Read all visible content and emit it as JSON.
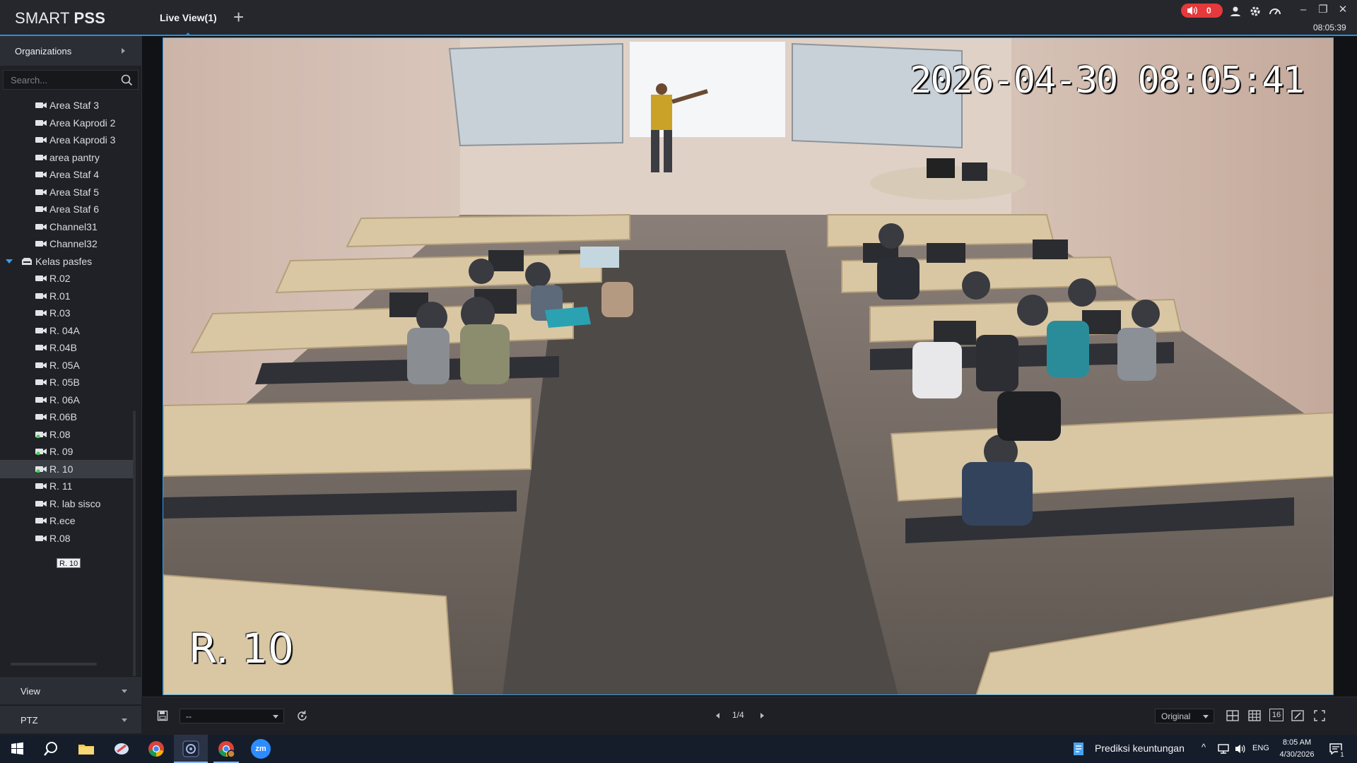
{
  "app": {
    "logo_light": "SMART ",
    "logo_bold": "PSS",
    "tab_label": "Live View(1)",
    "add_tab": "+",
    "alarm_count": "0",
    "clock": "08:05:39",
    "colors": {
      "accent": "#2b8fd6",
      "alarm": "#e5393b",
      "online_dot": "#3ecf4a"
    }
  },
  "sidebar": {
    "organizations_label": "Organizations",
    "search_placeholder": "Search...",
    "tree": [
      {
        "label": "Area Staf 3",
        "type": "camera",
        "online": false
      },
      {
        "label": "Area Kaprodi 2",
        "type": "camera",
        "online": false
      },
      {
        "label": "Area Kaprodi 3",
        "type": "camera",
        "online": false
      },
      {
        "label": "area pantry",
        "type": "camera",
        "online": false
      },
      {
        "label": "Area Staf 4",
        "type": "camera",
        "online": false
      },
      {
        "label": "Area Staf 5",
        "type": "camera",
        "online": false
      },
      {
        "label": "Area Staf 6",
        "type": "camera",
        "online": false
      },
      {
        "label": "Channel31",
        "type": "camera",
        "online": false
      },
      {
        "label": "Channel32",
        "type": "camera",
        "online": false
      },
      {
        "label": "Kelas pasfes",
        "type": "group",
        "online": false
      },
      {
        "label": "R.02",
        "type": "camera",
        "online": false
      },
      {
        "label": "R.01",
        "type": "camera",
        "online": false
      },
      {
        "label": "R.03",
        "type": "camera",
        "online": false
      },
      {
        "label": "R. 04A",
        "type": "camera",
        "online": false
      },
      {
        "label": "R.04B",
        "type": "camera",
        "online": false
      },
      {
        "label": "R. 05A",
        "type": "camera",
        "online": false
      },
      {
        "label": "R. 05B",
        "type": "camera",
        "online": false
      },
      {
        "label": "R. 06A",
        "type": "camera",
        "online": false
      },
      {
        "label": "R.06B",
        "type": "camera",
        "online": false
      },
      {
        "label": "R.08",
        "type": "camera",
        "online": true
      },
      {
        "label": "R. 09",
        "type": "camera",
        "online": true
      },
      {
        "label": "R. 10",
        "type": "camera",
        "online": true,
        "selected": true
      },
      {
        "label": "R. 11",
        "type": "camera",
        "online": false
      },
      {
        "label": "R. lab sisco",
        "type": "camera",
        "online": false
      },
      {
        "label": "R.ece",
        "type": "camera",
        "online": false
      },
      {
        "label": "R.08",
        "type": "camera",
        "online": false
      }
    ],
    "tooltip": "R. 10",
    "view_label": "View",
    "ptz_label": "PTZ"
  },
  "video": {
    "osd_timestamp": "2026-04-30  08:05:41",
    "osd_channel": "R. 10"
  },
  "toolbar": {
    "stream_select": "--",
    "page": "1/4",
    "ratio_select": "Original",
    "split_16": "16"
  },
  "taskbar": {
    "widget_text": "Prediksi keuntungan",
    "language": "ENG",
    "time": "8:05 AM",
    "date": "4/30/2026",
    "notification_count": "1",
    "zoom_label": "zm"
  }
}
